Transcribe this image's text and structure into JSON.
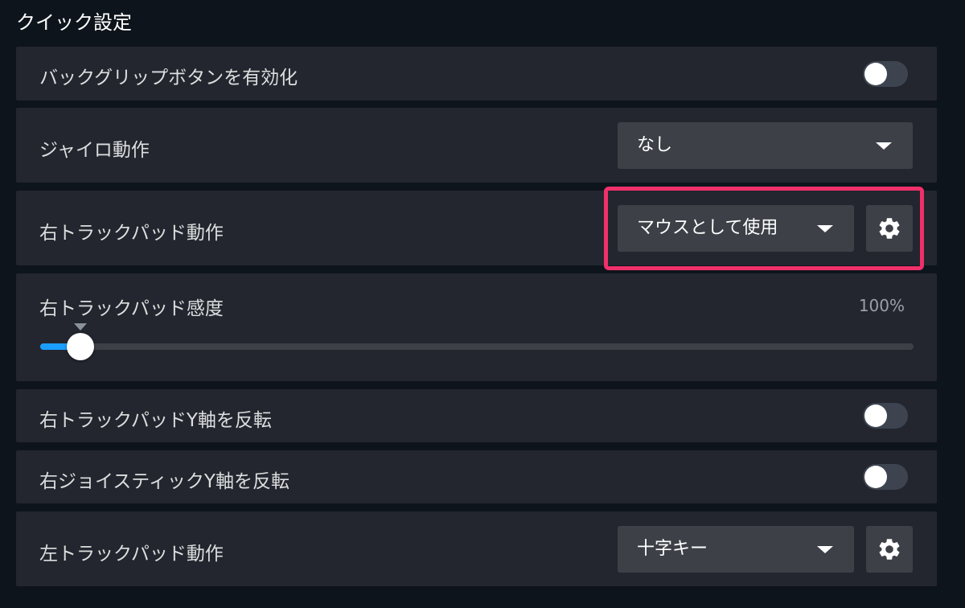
{
  "section_title": "クイック設定",
  "accent_color": "#1a9fff",
  "highlight_color": "#f0306b",
  "rows": {
    "back_grip": {
      "label": "バックグリップボタンを有効化",
      "toggle_on": false
    },
    "gyro": {
      "label": "ジャイロ動作",
      "dropdown_value": "なし"
    },
    "right_trackpad_behavior": {
      "label": "右トラックパッド動作",
      "dropdown_value": "マウスとして使用",
      "settings_icon": "gear-icon"
    },
    "right_trackpad_sensitivity": {
      "label": "右トラックパッド感度",
      "value_text": "100%",
      "slider_fraction": 0.05
    },
    "invert_trackpad_y": {
      "label": "右トラックパッドY軸を反転",
      "toggle_on": false
    },
    "invert_joystick_y": {
      "label": "右ジョイスティックY軸を反転",
      "toggle_on": false
    },
    "left_trackpad_behavior": {
      "label": "左トラックパッド動作",
      "dropdown_value": "十字キー",
      "settings_icon": "gear-icon"
    }
  }
}
